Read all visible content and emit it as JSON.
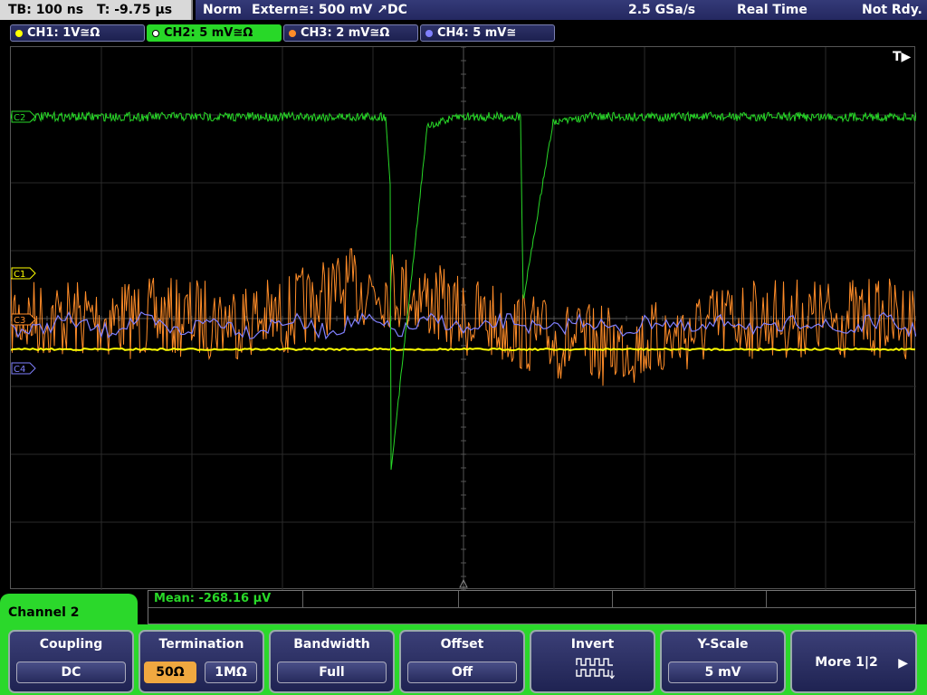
{
  "status": {
    "timebase": "TB: 100 ns",
    "trigger_time": "T: -9.75 µs",
    "trigger_mode": "Norm",
    "trigger_source": "Extern≅: 500 mV ↗DC",
    "sample_rate": "2.5 GSa/s",
    "acq_mode": "Real Time",
    "state": "Not Rdy."
  },
  "channels": [
    {
      "label": "CH1: 1V≅Ω",
      "color": "#ffff00",
      "marker": "C1"
    },
    {
      "label": "CH2: 5 mV≅Ω",
      "color": "#28d828",
      "marker": "C2"
    },
    {
      "label": "CH3: 2 mV≅Ω",
      "color": "#ff8c28",
      "marker": "C3"
    },
    {
      "label": "CH4: 5 mV≅",
      "color": "#8080ff",
      "marker": "C4"
    }
  ],
  "trigger_marker": "T▶",
  "measurement": {
    "mean": "Mean: -268.16 µV"
  },
  "menu": {
    "title": "Channel 2",
    "coupling": {
      "label": "Coupling",
      "value": "DC"
    },
    "termination": {
      "label": "Termination",
      "opt1": "50Ω",
      "opt2": "1MΩ",
      "selected": "50Ω"
    },
    "bandwidth": {
      "label": "Bandwidth",
      "value": "Full"
    },
    "offset": {
      "label": "Offset",
      "value": "Off"
    },
    "invert": {
      "label": "Invert",
      "icon": "invert-waveform-icon"
    },
    "yscale": {
      "label": "Y-Scale",
      "value": "5 mV"
    },
    "more": {
      "label": "More 1|2",
      "icon": "right-arrow-icon"
    }
  }
}
